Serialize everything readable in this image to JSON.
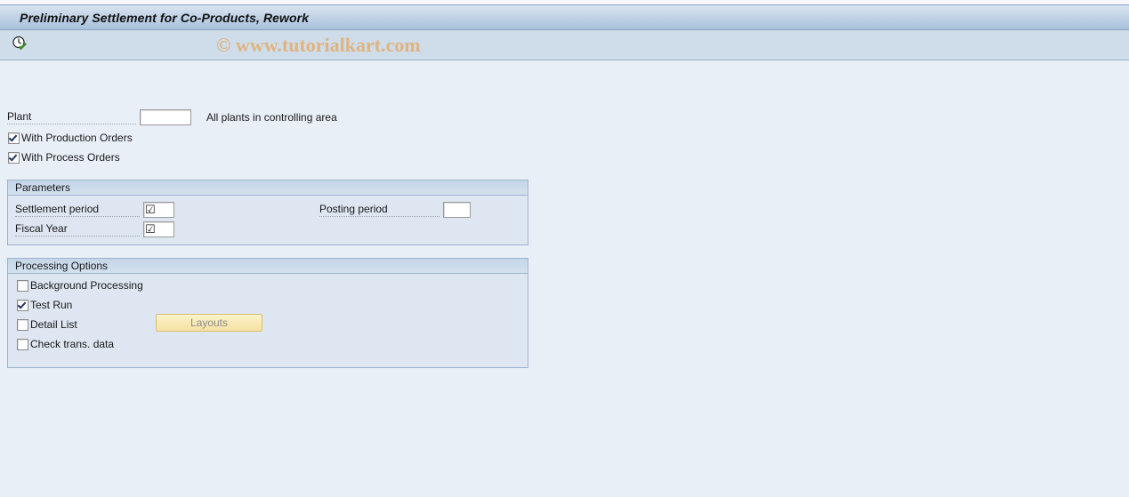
{
  "window": {
    "title": "Preliminary Settlement for Co-Products, Rework"
  },
  "toolbar": {
    "execute_icon": "clock-check-execute-icon",
    "execute_tooltip": "Execute",
    "watermark": "© www.tutorialkart.com"
  },
  "selection": {
    "plant": {
      "label": "Plant",
      "value": "",
      "placeholder": "",
      "hint": "All plants in controlling area"
    },
    "with_production_orders": {
      "label": "With Production Orders",
      "checked": true
    },
    "with_process_orders": {
      "label": "With Process Orders",
      "checked": true
    }
  },
  "parameters": {
    "title": "Parameters",
    "settlement_period": {
      "label": "Settlement period",
      "value": "",
      "glyph": "☑"
    },
    "fiscal_year": {
      "label": "Fiscal Year",
      "value": "",
      "glyph": "☑"
    },
    "posting_period": {
      "label": "Posting period",
      "value": "",
      "placeholder": ""
    }
  },
  "processing_options": {
    "title": "Processing Options",
    "background_processing": {
      "label": "Background Processing",
      "checked": false
    },
    "test_run": {
      "label": "Test Run",
      "checked": true
    },
    "detail_list": {
      "label": "Detail List",
      "checked": false
    },
    "check_trans_data": {
      "label": "Check trans. data",
      "checked": false
    },
    "layouts_button": {
      "label": "Layouts",
      "enabled": false
    }
  },
  "colors": {
    "page_background": "#e9eff7",
    "titlebar_top": "#d9e4f0",
    "titlebar_bottom": "#a9c1dd",
    "toolbar_background": "#cfdce9",
    "group_background": "#dde6f1",
    "group_border": "#9db4cd",
    "group_header_top": "#c5d6e8",
    "watermark": "#dfb480",
    "button_face": "#f9e9b5",
    "button_border": "#d9bd6c",
    "button_text_disabled": "#8d8d8d",
    "checkmark": "#26375e"
  }
}
